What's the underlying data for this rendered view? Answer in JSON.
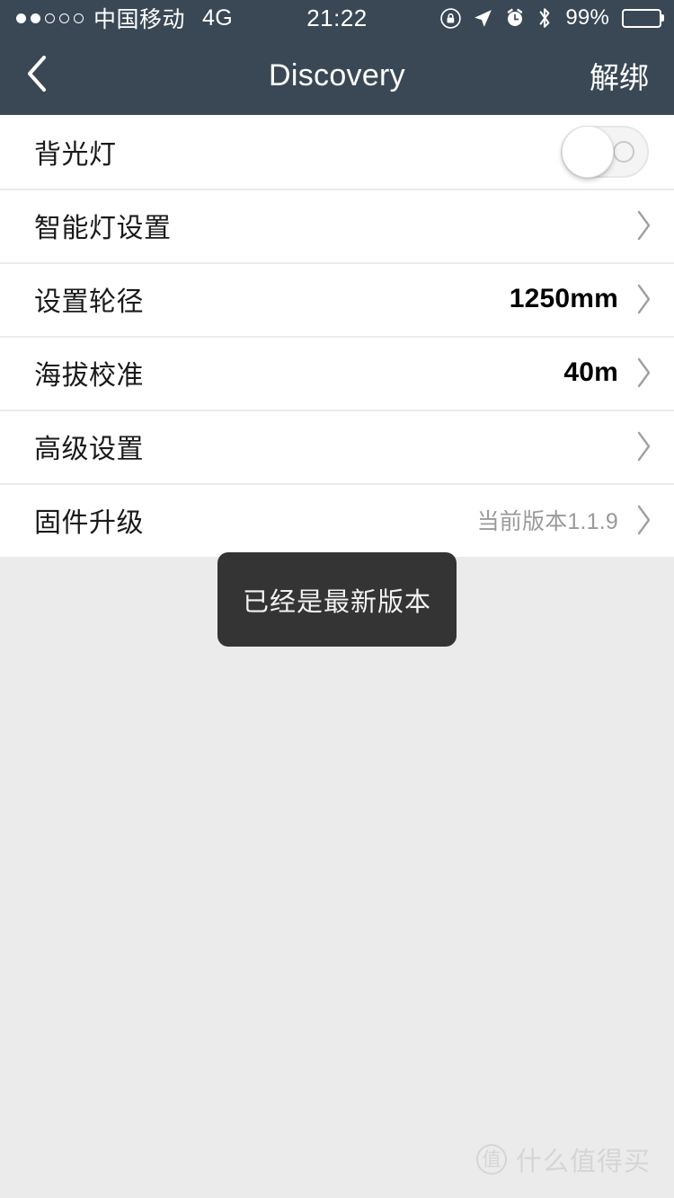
{
  "status_bar": {
    "signal_dots_filled": 2,
    "signal_dots_total": 5,
    "carrier": "中国移动",
    "network": "4G",
    "time": "21:22",
    "battery_percent": "99%",
    "icons": [
      "rotation-lock-icon",
      "location-arrow-icon",
      "alarm-clock-icon",
      "bluetooth-icon",
      "battery-icon"
    ],
    "background_color": "#3a4856"
  },
  "nav_bar": {
    "back_label": "back-chevron",
    "title": "Discovery",
    "action_label": "解绑",
    "background_color": "#3a4856",
    "text_color": "#ffffff"
  },
  "list": {
    "rows": [
      {
        "label": "背光灯",
        "value": "",
        "control": "toggle",
        "toggle_on": false,
        "chevron": false
      },
      {
        "label": "智能灯设置",
        "value": "",
        "control": "chevron",
        "chevron": true
      },
      {
        "label": "设置轮径",
        "value": "1250mm",
        "control": "value-chevron",
        "chevron": true,
        "value_muted": false
      },
      {
        "label": "海拔校准",
        "value": "40m",
        "control": "value-chevron",
        "chevron": true,
        "value_muted": false
      },
      {
        "label": "高级设置",
        "value": "",
        "control": "chevron",
        "chevron": true
      },
      {
        "label": "固件升级",
        "value": "当前版本1.1.9",
        "control": "value-chevron",
        "chevron": true,
        "value_muted": true
      }
    ],
    "background_color": "#ffffff",
    "separator_color": "#ebebeb"
  },
  "toast": {
    "message": "已经是最新版本",
    "background_color": "#343434",
    "text_color": "#f2f2f2"
  },
  "watermark": {
    "badge": "值",
    "text": "什么值得买",
    "color": "#c9c9c9"
  },
  "page": {
    "background_color": "#ebebeb"
  }
}
